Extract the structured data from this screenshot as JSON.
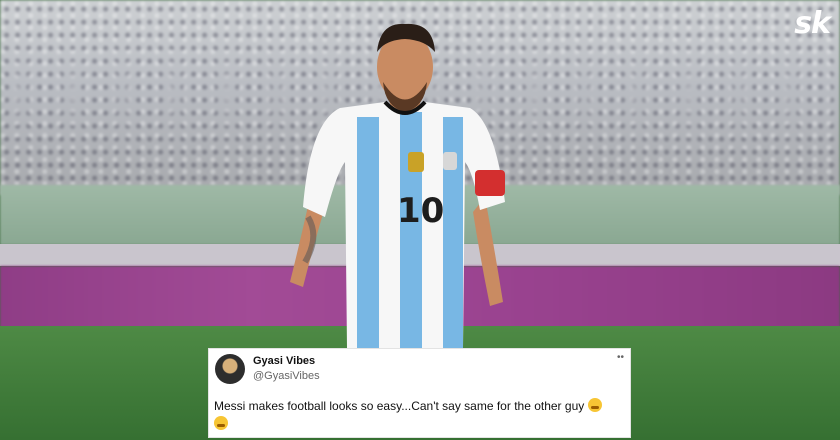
{
  "brand": {
    "logo_text": "sk"
  },
  "player": {
    "shirt_number": "10"
  },
  "tweet": {
    "display_name": "Gyasi Vibes",
    "handle": "@GyasiVibes",
    "text": "Messi makes football looks so easy...Can't say same for the other guy",
    "more_label": "••"
  },
  "colors": {
    "shirt_blue": "#78b7e4",
    "shirt_white": "#f7f7f7",
    "captain_band": "#d32f2f",
    "pitch": "#3f7a39",
    "board": "#9a4390"
  }
}
